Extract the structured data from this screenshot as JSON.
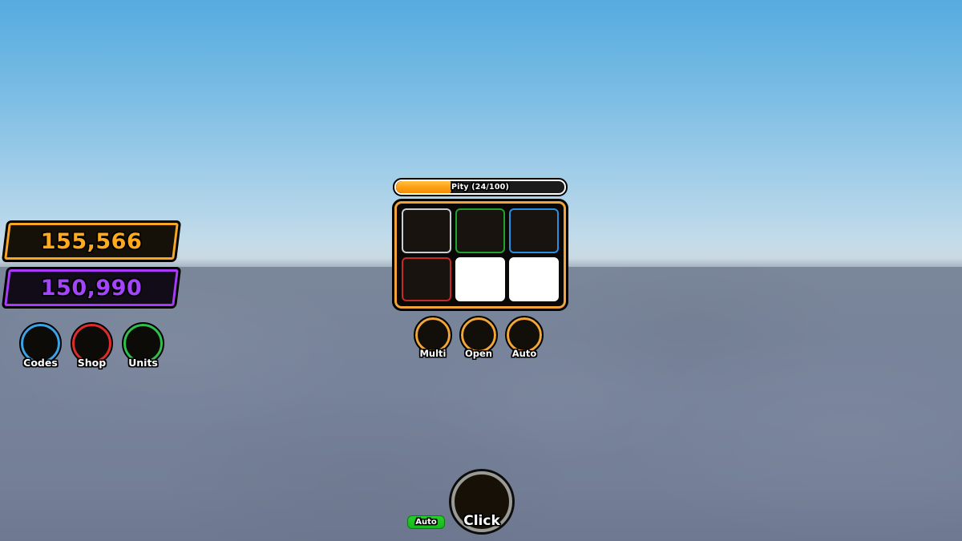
{
  "scene": {
    "sky_top_color": "#57abdf",
    "sky_horizon_color": "#cfdfe6",
    "ground_color": "#7a8699"
  },
  "hud": {
    "currencies": [
      {
        "name": "gold-currency",
        "value": "155,566",
        "color": "#ffaa1d",
        "border": "#f5a623"
      },
      {
        "name": "gem-currency",
        "value": "150,990",
        "color": "#a445fd",
        "border": "#a83bfb"
      }
    ],
    "nav_buttons": [
      {
        "label": "Codes",
        "ring_color": "#3ba3e8",
        "glow": false
      },
      {
        "label": "Shop",
        "ring_color": "#e02b2b",
        "glow": true
      },
      {
        "label": "Units",
        "ring_color": "#2ec04a",
        "glow": false
      }
    ]
  },
  "gacha": {
    "pity": {
      "label": "Pity (24/100)",
      "current": 24,
      "max": 100,
      "fill_percent": 34,
      "fill_color": "#ffa012"
    },
    "crate_border_color": "#f2a43a",
    "cells": [
      {
        "slot": 1,
        "border_color": "#c9cdd4",
        "filled": false
      },
      {
        "slot": 2,
        "border_color": "#1fa32c",
        "filled": false
      },
      {
        "slot": 3,
        "border_color": "#2b8fe0",
        "filled": false
      },
      {
        "slot": 4,
        "border_color": "#c42b26",
        "filled": false
      },
      {
        "slot": 5,
        "border_color": "#ffffff",
        "filled": true
      },
      {
        "slot": 6,
        "border_color": "#ffffff",
        "filled": true
      }
    ],
    "actions": [
      {
        "label": "Multi",
        "ring_color": "#f2a636"
      },
      {
        "label": "Open",
        "ring_color": "#f2a636"
      },
      {
        "label": "Auto",
        "ring_color": "#f2a636"
      }
    ]
  },
  "bottom": {
    "auto_toggle_label": "Auto",
    "auto_toggle_color": "#1dc422",
    "click_label": "Click"
  }
}
